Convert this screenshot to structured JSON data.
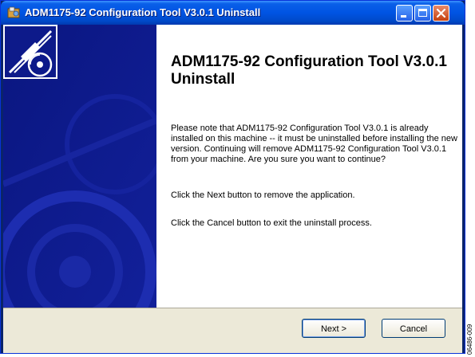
{
  "window": {
    "title": "ADM1175-92 Configuration Tool V3.0.1 Uninstall"
  },
  "heading": "ADM1175-92 Configuration Tool V3.0.1 Uninstall",
  "paragraphs": {
    "notice": "Please note that ADM1175-92 Configuration Tool V3.0.1 is already installed on this machine -- it must be uninstalled before installing the new version. Continuing will remove ADM1175-92 Configuration Tool V3.0.1 from your machine. Are you sure you want to continue?",
    "next_hint": "Click the Next button to remove the application.",
    "cancel_hint": "Click the Cancel button to exit the uninstall process."
  },
  "buttons": {
    "next_label": "Next >",
    "cancel_label": "Cancel"
  },
  "side_code": "06486-009",
  "icons": [
    "app-installer-icon",
    "minimize-icon",
    "maximize-icon",
    "close-icon",
    "installer-logo-icon"
  ],
  "colors": {
    "titlebar": "#0054e3",
    "banner": "#0d1a8a",
    "footer": "#ece9d8",
    "close_button": "#c6410f"
  }
}
